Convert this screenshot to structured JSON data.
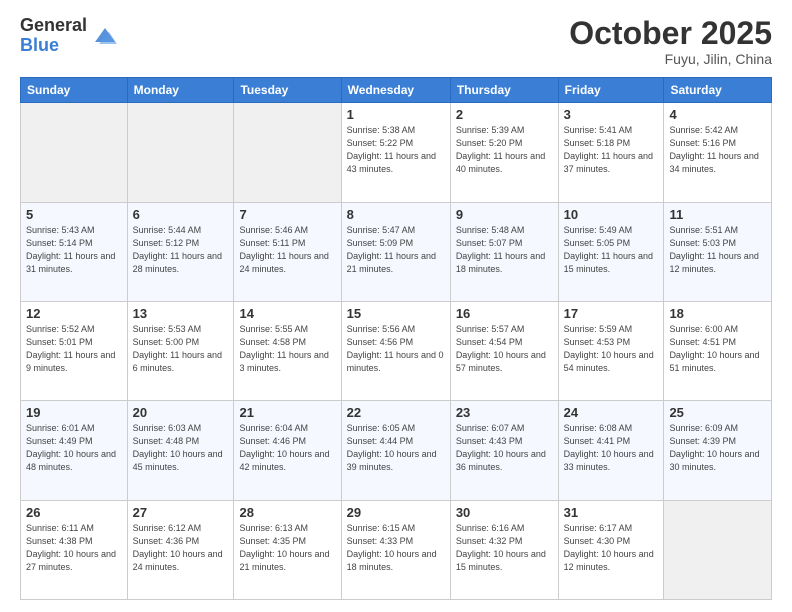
{
  "logo": {
    "general": "General",
    "blue": "Blue"
  },
  "header": {
    "month": "October 2025",
    "location": "Fuyu, Jilin, China"
  },
  "days_of_week": [
    "Sunday",
    "Monday",
    "Tuesday",
    "Wednesday",
    "Thursday",
    "Friday",
    "Saturday"
  ],
  "weeks": [
    [
      {
        "day": "",
        "sunrise": "",
        "sunset": "",
        "daylight": ""
      },
      {
        "day": "",
        "sunrise": "",
        "sunset": "",
        "daylight": ""
      },
      {
        "day": "",
        "sunrise": "",
        "sunset": "",
        "daylight": ""
      },
      {
        "day": "1",
        "sunrise": "Sunrise: 5:38 AM",
        "sunset": "Sunset: 5:22 PM",
        "daylight": "Daylight: 11 hours and 43 minutes."
      },
      {
        "day": "2",
        "sunrise": "Sunrise: 5:39 AM",
        "sunset": "Sunset: 5:20 PM",
        "daylight": "Daylight: 11 hours and 40 minutes."
      },
      {
        "day": "3",
        "sunrise": "Sunrise: 5:41 AM",
        "sunset": "Sunset: 5:18 PM",
        "daylight": "Daylight: 11 hours and 37 minutes."
      },
      {
        "day": "4",
        "sunrise": "Sunrise: 5:42 AM",
        "sunset": "Sunset: 5:16 PM",
        "daylight": "Daylight: 11 hours and 34 minutes."
      }
    ],
    [
      {
        "day": "5",
        "sunrise": "Sunrise: 5:43 AM",
        "sunset": "Sunset: 5:14 PM",
        "daylight": "Daylight: 11 hours and 31 minutes."
      },
      {
        "day": "6",
        "sunrise": "Sunrise: 5:44 AM",
        "sunset": "Sunset: 5:12 PM",
        "daylight": "Daylight: 11 hours and 28 minutes."
      },
      {
        "day": "7",
        "sunrise": "Sunrise: 5:46 AM",
        "sunset": "Sunset: 5:11 PM",
        "daylight": "Daylight: 11 hours and 24 minutes."
      },
      {
        "day": "8",
        "sunrise": "Sunrise: 5:47 AM",
        "sunset": "Sunset: 5:09 PM",
        "daylight": "Daylight: 11 hours and 21 minutes."
      },
      {
        "day": "9",
        "sunrise": "Sunrise: 5:48 AM",
        "sunset": "Sunset: 5:07 PM",
        "daylight": "Daylight: 11 hours and 18 minutes."
      },
      {
        "day": "10",
        "sunrise": "Sunrise: 5:49 AM",
        "sunset": "Sunset: 5:05 PM",
        "daylight": "Daylight: 11 hours and 15 minutes."
      },
      {
        "day": "11",
        "sunrise": "Sunrise: 5:51 AM",
        "sunset": "Sunset: 5:03 PM",
        "daylight": "Daylight: 11 hours and 12 minutes."
      }
    ],
    [
      {
        "day": "12",
        "sunrise": "Sunrise: 5:52 AM",
        "sunset": "Sunset: 5:01 PM",
        "daylight": "Daylight: 11 hours and 9 minutes."
      },
      {
        "day": "13",
        "sunrise": "Sunrise: 5:53 AM",
        "sunset": "Sunset: 5:00 PM",
        "daylight": "Daylight: 11 hours and 6 minutes."
      },
      {
        "day": "14",
        "sunrise": "Sunrise: 5:55 AM",
        "sunset": "Sunset: 4:58 PM",
        "daylight": "Daylight: 11 hours and 3 minutes."
      },
      {
        "day": "15",
        "sunrise": "Sunrise: 5:56 AM",
        "sunset": "Sunset: 4:56 PM",
        "daylight": "Daylight: 11 hours and 0 minutes."
      },
      {
        "day": "16",
        "sunrise": "Sunrise: 5:57 AM",
        "sunset": "Sunset: 4:54 PM",
        "daylight": "Daylight: 10 hours and 57 minutes."
      },
      {
        "day": "17",
        "sunrise": "Sunrise: 5:59 AM",
        "sunset": "Sunset: 4:53 PM",
        "daylight": "Daylight: 10 hours and 54 minutes."
      },
      {
        "day": "18",
        "sunrise": "Sunrise: 6:00 AM",
        "sunset": "Sunset: 4:51 PM",
        "daylight": "Daylight: 10 hours and 51 minutes."
      }
    ],
    [
      {
        "day": "19",
        "sunrise": "Sunrise: 6:01 AM",
        "sunset": "Sunset: 4:49 PM",
        "daylight": "Daylight: 10 hours and 48 minutes."
      },
      {
        "day": "20",
        "sunrise": "Sunrise: 6:03 AM",
        "sunset": "Sunset: 4:48 PM",
        "daylight": "Daylight: 10 hours and 45 minutes."
      },
      {
        "day": "21",
        "sunrise": "Sunrise: 6:04 AM",
        "sunset": "Sunset: 4:46 PM",
        "daylight": "Daylight: 10 hours and 42 minutes."
      },
      {
        "day": "22",
        "sunrise": "Sunrise: 6:05 AM",
        "sunset": "Sunset: 4:44 PM",
        "daylight": "Daylight: 10 hours and 39 minutes."
      },
      {
        "day": "23",
        "sunrise": "Sunrise: 6:07 AM",
        "sunset": "Sunset: 4:43 PM",
        "daylight": "Daylight: 10 hours and 36 minutes."
      },
      {
        "day": "24",
        "sunrise": "Sunrise: 6:08 AM",
        "sunset": "Sunset: 4:41 PM",
        "daylight": "Daylight: 10 hours and 33 minutes."
      },
      {
        "day": "25",
        "sunrise": "Sunrise: 6:09 AM",
        "sunset": "Sunset: 4:39 PM",
        "daylight": "Daylight: 10 hours and 30 minutes."
      }
    ],
    [
      {
        "day": "26",
        "sunrise": "Sunrise: 6:11 AM",
        "sunset": "Sunset: 4:38 PM",
        "daylight": "Daylight: 10 hours and 27 minutes."
      },
      {
        "day": "27",
        "sunrise": "Sunrise: 6:12 AM",
        "sunset": "Sunset: 4:36 PM",
        "daylight": "Daylight: 10 hours and 24 minutes."
      },
      {
        "day": "28",
        "sunrise": "Sunrise: 6:13 AM",
        "sunset": "Sunset: 4:35 PM",
        "daylight": "Daylight: 10 hours and 21 minutes."
      },
      {
        "day": "29",
        "sunrise": "Sunrise: 6:15 AM",
        "sunset": "Sunset: 4:33 PM",
        "daylight": "Daylight: 10 hours and 18 minutes."
      },
      {
        "day": "30",
        "sunrise": "Sunrise: 6:16 AM",
        "sunset": "Sunset: 4:32 PM",
        "daylight": "Daylight: 10 hours and 15 minutes."
      },
      {
        "day": "31",
        "sunrise": "Sunrise: 6:17 AM",
        "sunset": "Sunset: 4:30 PM",
        "daylight": "Daylight: 10 hours and 12 minutes."
      },
      {
        "day": "",
        "sunrise": "",
        "sunset": "",
        "daylight": ""
      }
    ]
  ]
}
